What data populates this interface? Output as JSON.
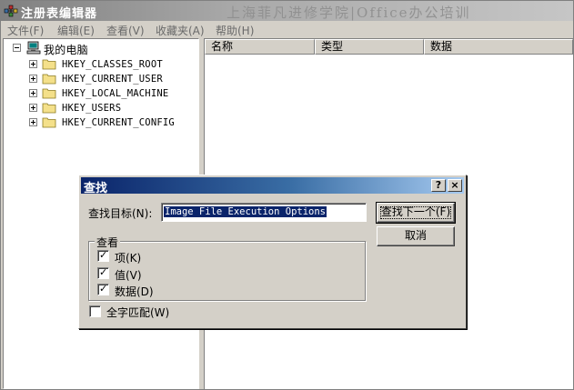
{
  "window": {
    "title": "注册表编辑器",
    "watermark": "上海菲凡进修学院|Office办公培训"
  },
  "menu": [
    "文件(F)",
    "编辑(E)",
    "查看(V)",
    "收藏夹(A)",
    "帮助(H)"
  ],
  "tree": {
    "root": "我的电脑",
    "keys": [
      "HKEY_CLASSES_ROOT",
      "HKEY_CURRENT_USER",
      "HKEY_LOCAL_MACHINE",
      "HKEY_USERS",
      "HKEY_CURRENT_CONFIG"
    ]
  },
  "list": {
    "columns": [
      "名称",
      "类型",
      "数据"
    ]
  },
  "dialog": {
    "title": "查找",
    "help_button": "?",
    "close_button": "×",
    "find_label": "查找目标(N):",
    "find_value": "Image File Execution Options",
    "find_next_button": "查找下一个(F)",
    "cancel_button": "取消",
    "look_at_label": "查看",
    "options": [
      {
        "label": "项(K)",
        "checked": true
      },
      {
        "label": "值(V)",
        "checked": true
      },
      {
        "label": "数据(D)",
        "checked": true
      }
    ],
    "match_whole": {
      "label": "全字匹配(W)",
      "checked": false
    }
  }
}
